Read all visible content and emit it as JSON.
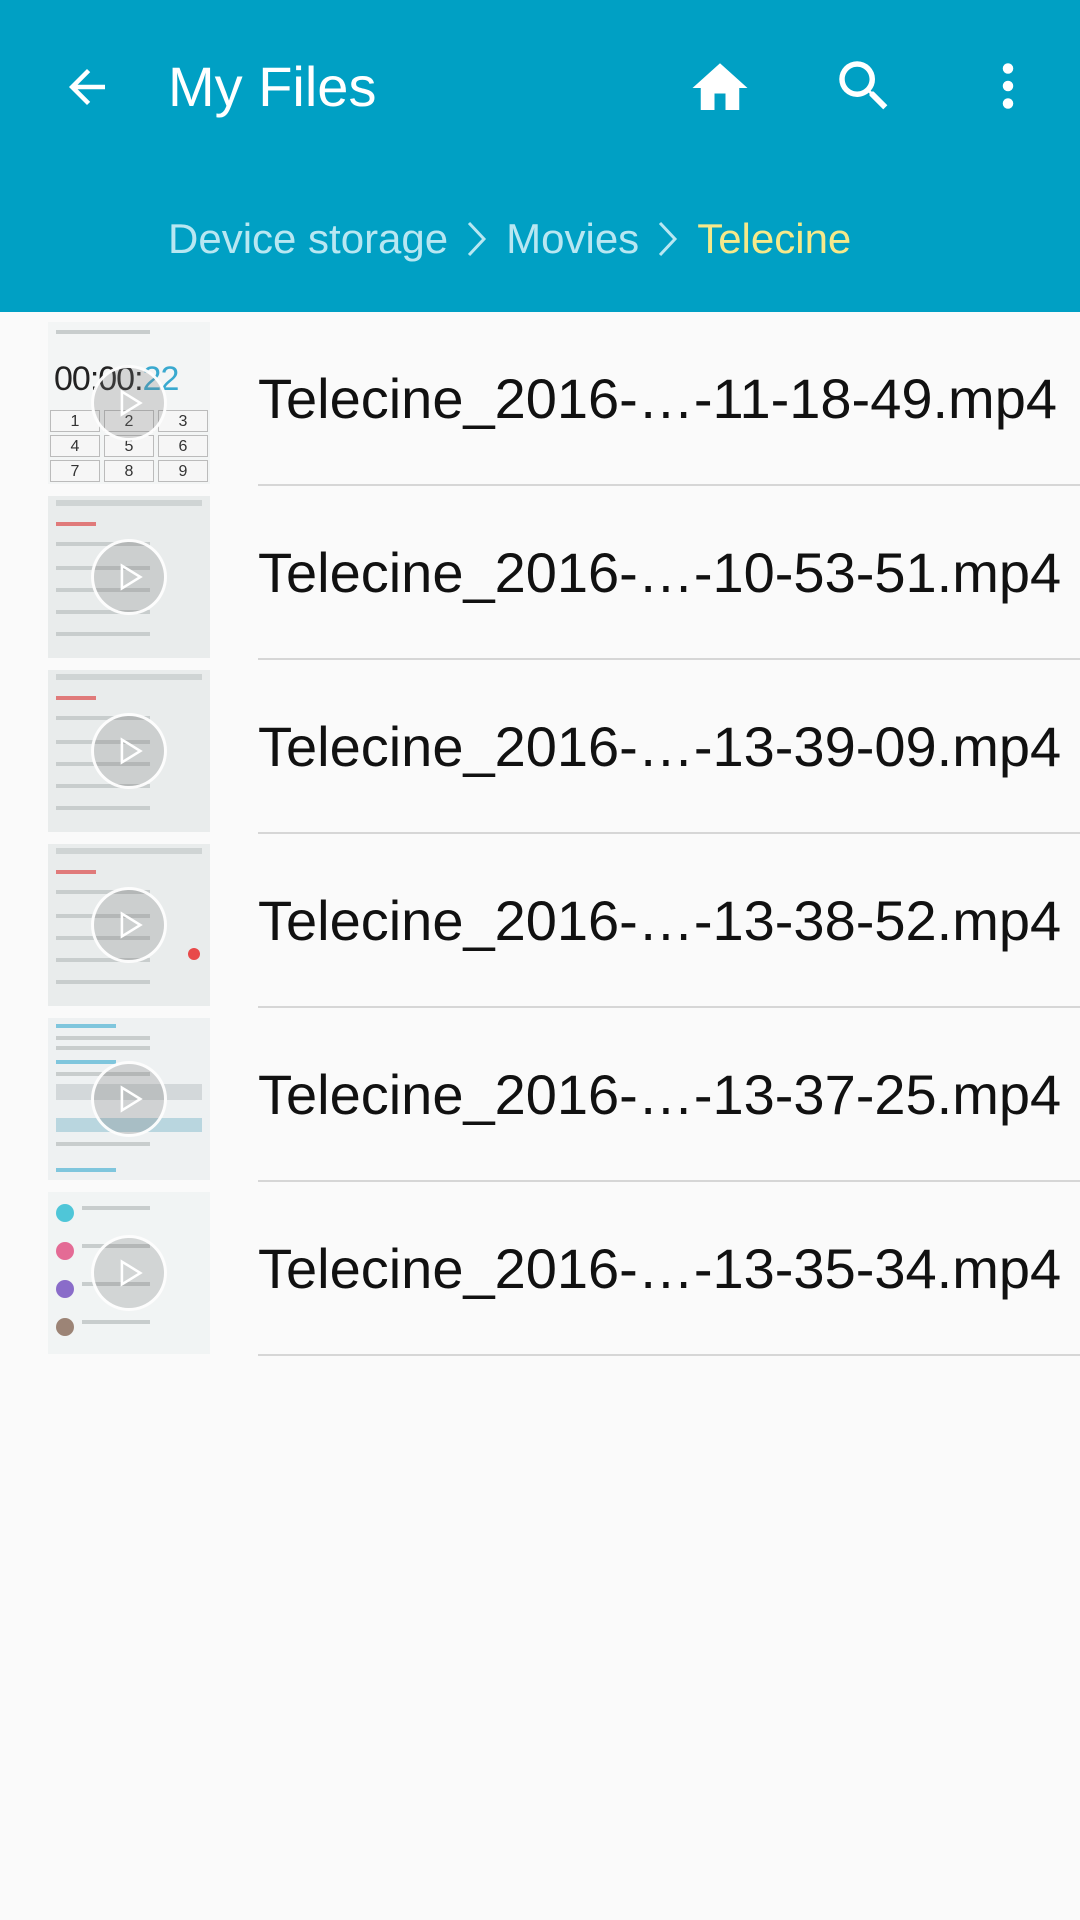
{
  "appbar": {
    "title": "My Files",
    "background_color": "#00a0c4",
    "icons": [
      "back-arrow-icon",
      "home-icon",
      "search-icon",
      "more-vert-icon"
    ]
  },
  "breadcrumb": {
    "items": [
      "Device storage",
      "Movies",
      "Telecine"
    ],
    "current_color": "#f6e98a"
  },
  "files": [
    {
      "name": "Telecine_2016-…-11-18-49.mp4",
      "thumbnail": "stopwatch-keypad"
    },
    {
      "name": "Telecine_2016-…-10-53-51.mp4",
      "thumbnail": "settings-list"
    },
    {
      "name": "Telecine_2016-…-13-39-09.mp4",
      "thumbnail": "settings-list"
    },
    {
      "name": "Telecine_2016-…-13-38-52.mp4",
      "thumbnail": "settings-list-toggle"
    },
    {
      "name": "Telecine_2016-…-13-37-25.mp4",
      "thumbnail": "email-list"
    },
    {
      "name": "Telecine_2016-…-13-35-34.mp4",
      "thumbnail": "contacts-list"
    }
  ],
  "thumbnail_clock": {
    "main": "00:00",
    "seconds": "22"
  },
  "thumbnail_keypad": [
    "1",
    "2",
    "3",
    "4",
    "5",
    "6",
    "7",
    "8",
    "9"
  ]
}
